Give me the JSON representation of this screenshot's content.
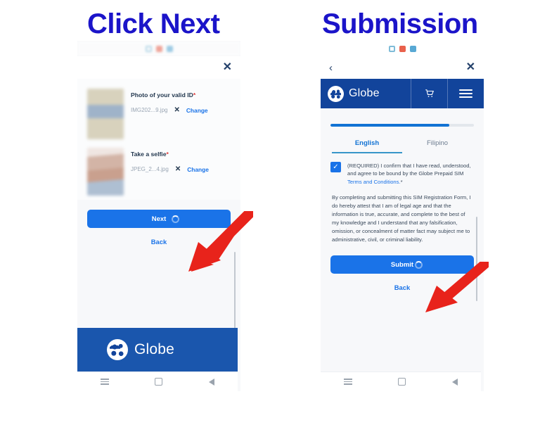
{
  "titles": {
    "left": "Click Next",
    "right": "Submission",
    "color": "#1b14c9"
  },
  "left_phone": {
    "chrome_chips": [
      "chip-blue-outline",
      "chip-red",
      "chip-blue"
    ],
    "topnav": {
      "close_icon": "✕"
    },
    "uploads": [
      {
        "label": "Photo of your valid ID",
        "required_mark": "*",
        "file_name": "IMG202...9.jpg",
        "remove_icon": "✕",
        "change_label": "Change",
        "thumb": "id-card-photo"
      },
      {
        "label": "Take a selfie",
        "required_mark": "*",
        "file_name": "JPEG_2...4.jpg",
        "remove_icon": "✕",
        "change_label": "Change",
        "thumb": "selfie-photo"
      }
    ],
    "primary_button": "Next",
    "back_link": "Back",
    "footer_brand": "Globe",
    "android_nav": [
      "recents",
      "home",
      "back"
    ]
  },
  "right_phone": {
    "chrome_chips": [
      "chip-blue-outline",
      "chip-red",
      "chip-blue"
    ],
    "topnav": {
      "back_icon": "‹",
      "close_icon": "✕"
    },
    "header": {
      "brand": "Globe",
      "cart_icon": "🛒",
      "menu_icon": "hamburger-menu"
    },
    "progress_percent": 83,
    "language_tabs": [
      {
        "label": "English",
        "active": true
      },
      {
        "label": "Filipino",
        "active": false
      }
    ],
    "consent": {
      "checked": true,
      "check_mark": "✓",
      "text_before": "(REQUIRED) I confirm that I have read, understood, and agree to be bound by the Globe Prepaid SIM ",
      "link_text": "Terms and Conditions.",
      "text_after": "*"
    },
    "legal_paragraph": "By completing and submitting this SIM Registration Form, I do hereby attest that I am of legal age and that the information is true, accurate, and complete to the best of my knowledge and I understand that any falsification, omission, or concealment of matter fact may subject me to administrative, civil, or criminal liability.",
    "primary_button": "Submit",
    "back_link": "Back",
    "android_nav": [
      "recents",
      "home",
      "back"
    ]
  },
  "annotations": {
    "arrow_color": "#e8231b",
    "arrows": [
      {
        "name": "arrow-to-next-button",
        "points_at": "Next"
      },
      {
        "name": "arrow-to-submit-button",
        "points_at": "Submit"
      }
    ]
  },
  "colors": {
    "brand_blue": "#12449b",
    "cta_blue": "#1a73e8",
    "title_blue": "#1b14c9",
    "arrow_red": "#e8231b",
    "screen_bg": "#f7f8fa"
  }
}
